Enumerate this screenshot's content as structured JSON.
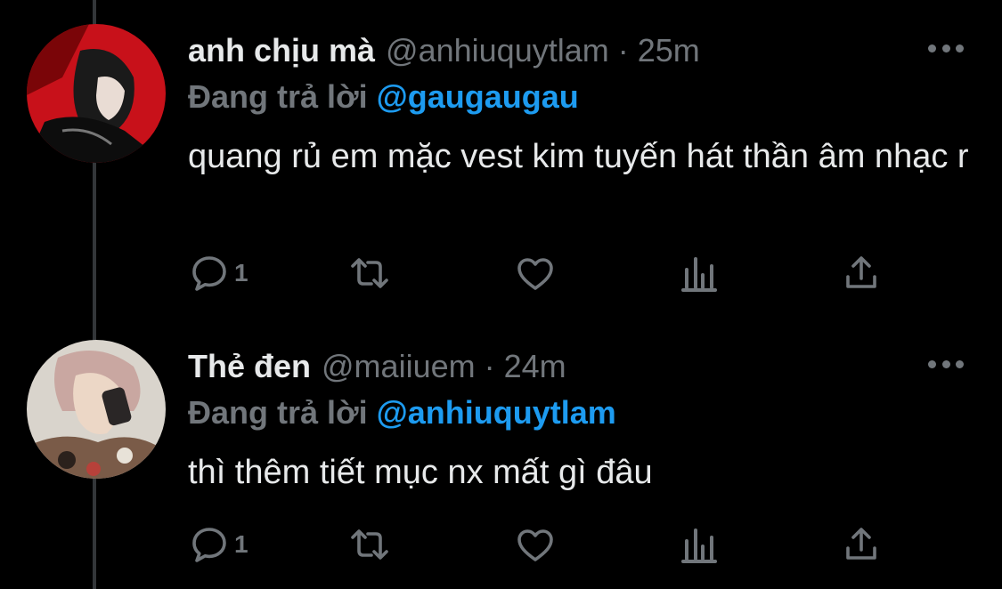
{
  "tweets": [
    {
      "name": "anh chịu mà",
      "handle": "@anhiuquytlam",
      "separator": "·",
      "time": "25m",
      "replying_prefix": "Đang trả lời",
      "replying_to": "@gaugaugau",
      "text": "quang rủ em mặc vest kim tuyến hát thần âm nhạc r",
      "reply_count": "1",
      "icons": [
        "more-icon",
        "reply-icon",
        "retweet-icon",
        "like-icon",
        "stats-icon",
        "share-icon"
      ]
    },
    {
      "name": "Thẻ đen",
      "handle": "@maiiuem",
      "separator": "·",
      "time": "24m",
      "replying_prefix": "Đang trả lời",
      "replying_to": "@anhiuquytlam",
      "text": "thì thêm tiết mục nx mất gì đâu",
      "reply_count": "1",
      "icons": [
        "more-icon",
        "reply-icon",
        "retweet-icon",
        "like-icon",
        "stats-icon",
        "share-icon"
      ]
    }
  ],
  "colors": {
    "background": "#000000",
    "primary_text": "#e7e9ea",
    "secondary_text": "#71767b",
    "mention": "#1d9bf0",
    "thread_line": "#333639"
  }
}
